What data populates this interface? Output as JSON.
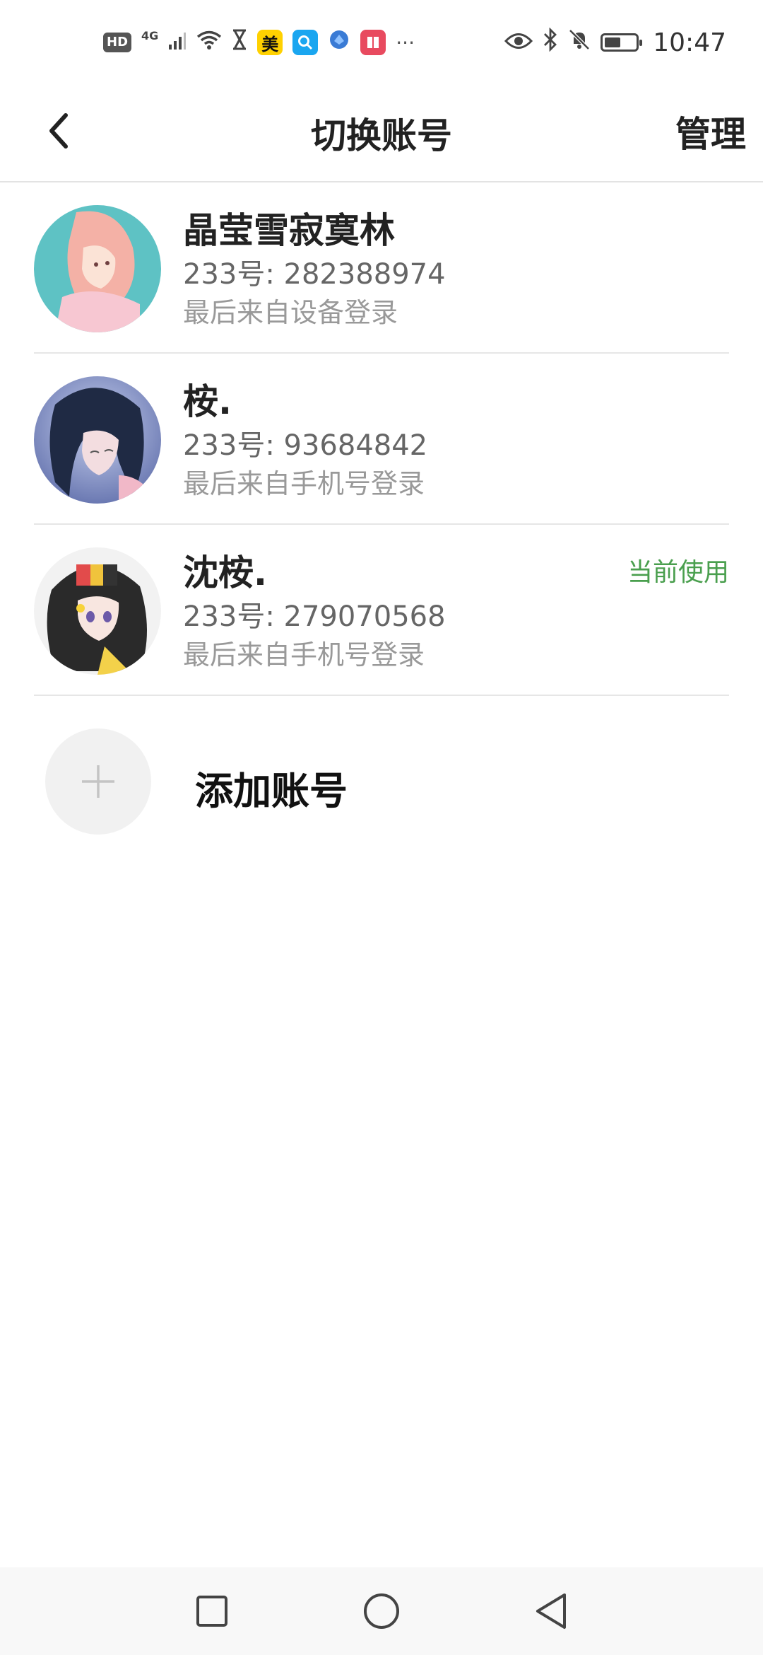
{
  "status_bar": {
    "hd": "HD",
    "network": "4G",
    "app_meituan": "美",
    "more": "···",
    "time": "10:47",
    "icons": [
      "signal-icon",
      "wifi-icon",
      "hourglass-icon",
      "meituan-icon",
      "search-app-icon",
      "browser-icon",
      "book-icon",
      "eye-icon",
      "bluetooth-icon",
      "bell-muted-icon",
      "battery-icon"
    ]
  },
  "header": {
    "title": "切换账号",
    "manage": "管理",
    "back_icon": "chevron-left-icon"
  },
  "accounts": [
    {
      "name": "晶莹雪寂寞林",
      "id": "233号: 282388974",
      "login": "最后来自设备登录",
      "badge": "",
      "avatar_colors": [
        "#58bcc0",
        "#f2a7a0"
      ]
    },
    {
      "name": "桉.",
      "id": "233号: 93684842",
      "login": "最后来自手机号登录",
      "badge": "",
      "avatar_colors": [
        "#6a78b8",
        "#1f2a44"
      ]
    },
    {
      "name": "沈桉.",
      "id": "233号: 279070568",
      "login": "最后来自手机号登录",
      "badge": "当前使用",
      "avatar_colors": [
        "#f4f4f4",
        "#2a2a2a"
      ]
    }
  ],
  "add_account": {
    "label": "添加账号",
    "icon": "plus-icon"
  },
  "nav": {
    "icons": [
      "recents-square-icon",
      "home-circle-icon",
      "back-triangle-icon"
    ]
  }
}
